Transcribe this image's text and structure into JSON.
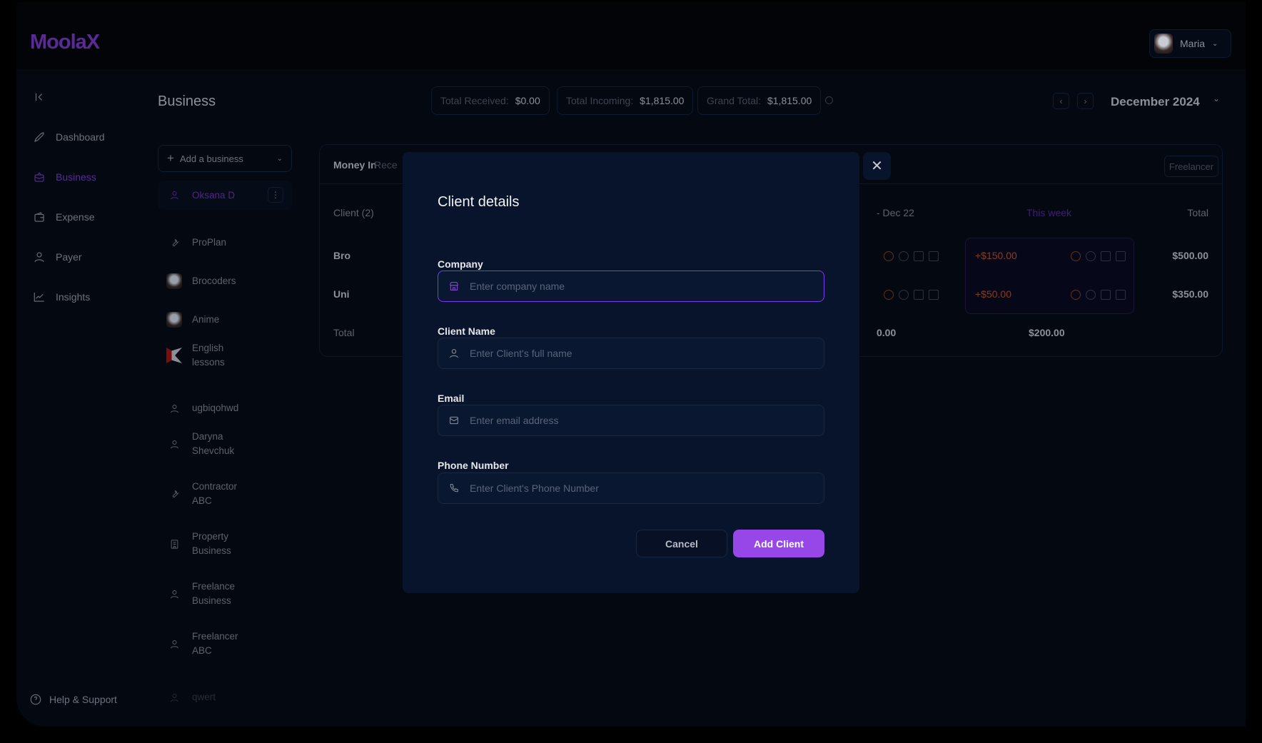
{
  "app": {
    "logo": "MoolaX",
    "user_name": "Maria"
  },
  "sidebar": {
    "items": [
      {
        "label": "Dashboard",
        "icon": "rocket-icon"
      },
      {
        "label": "Business",
        "icon": "briefcase-icon",
        "active": true
      },
      {
        "label": "Expense",
        "icon": "wallet-icon"
      },
      {
        "label": "Payer",
        "icon": "user-icon"
      },
      {
        "label": "Insights",
        "icon": "chart-line-icon"
      }
    ],
    "help": "Help & Support"
  },
  "header": {
    "title": "Business",
    "totals": [
      {
        "label": "Total Received:",
        "value": "$0.00"
      },
      {
        "label": "Total Incoming:",
        "value": "$1,815.00"
      },
      {
        "label": "Grand Total:",
        "value": "$1,815.00"
      }
    ],
    "month": "December 2024"
  },
  "businesses": {
    "add_label": "Add a business",
    "items": [
      {
        "label": "Oksana D",
        "icon": "user-icon",
        "active": true
      },
      {
        "label": "ProPlan",
        "icon": "wrench-icon"
      },
      {
        "label": "Brocoders",
        "icon": "avatar"
      },
      {
        "label": "Anime",
        "icon": "avatar"
      },
      {
        "label": "English lessons",
        "icon": "logo-k"
      },
      {
        "label": "ugbiqohwd",
        "icon": "user-icon"
      },
      {
        "label": "Daryna Shevchuk",
        "icon": "user-icon"
      },
      {
        "label": "Contractor ABC",
        "icon": "wrench-icon"
      },
      {
        "label": "Property Business",
        "icon": "building-icon"
      },
      {
        "label": "Freelance Business",
        "icon": "user-icon"
      },
      {
        "label": "Freelancer ABC",
        "icon": "user-icon"
      },
      {
        "label": "qwert",
        "icon": "user-icon"
      }
    ]
  },
  "table": {
    "tab_active": "Money In",
    "tab_next": "Rece",
    "filter": "Freelancer",
    "col_client": "Client (2)",
    "col_week_prev": "- Dec 22",
    "col_this_week": "This week",
    "col_total": "Total",
    "rows": [
      {
        "client": "Bro",
        "this_week": "+$150.00",
        "total": "$500.00"
      },
      {
        "client": "Uni",
        "this_week": "+$50.00",
        "total": "$350.00"
      }
    ],
    "total_label": "Total",
    "total_prev": "0.00",
    "total_this_week": "$200.00"
  },
  "modal": {
    "title": "Client details",
    "fields": [
      {
        "label": "Company",
        "placeholder": "Enter company name",
        "icon": "store-icon"
      },
      {
        "label": "Client Name",
        "placeholder": "Enter Client's full name",
        "icon": "user-icon"
      },
      {
        "label": "Email",
        "placeholder": "Enter email address",
        "icon": "mail-icon"
      },
      {
        "label": "Phone Number",
        "placeholder": "Enter Client's Phone Number",
        "icon": "phone-icon"
      }
    ],
    "cancel": "Cancel",
    "submit": "Add Client"
  },
  "colors": {
    "accent": "#9747e8",
    "modal_bg": "#08142b",
    "negative": "#c2501f"
  }
}
